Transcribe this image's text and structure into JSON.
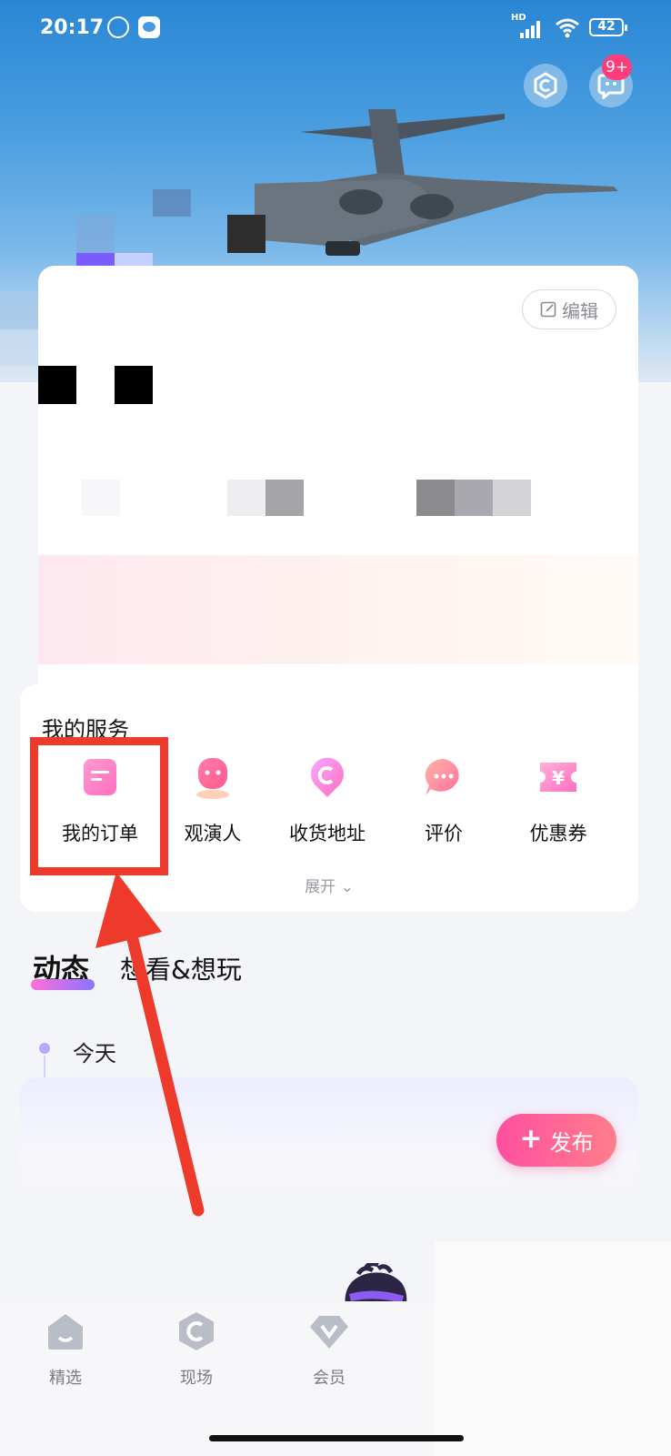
{
  "status_bar": {
    "time": "20:17",
    "network_label": "HD",
    "battery": "42"
  },
  "header": {
    "message_badge": "9+"
  },
  "profile": {
    "edit_label": "编辑"
  },
  "services": {
    "title": "我的服务",
    "items": [
      {
        "label": "我的订单",
        "icon": "order-icon"
      },
      {
        "label": "观演人",
        "icon": "audience-icon"
      },
      {
        "label": "收货地址",
        "icon": "address-icon"
      },
      {
        "label": "评价",
        "icon": "comment-icon"
      },
      {
        "label": "优惠券",
        "icon": "coupon-icon"
      }
    ],
    "expand_label": "展开"
  },
  "feed": {
    "tab_active": "动态",
    "tab_other": "想看&想玩",
    "today_label": "今天",
    "publish_label": "发布"
  },
  "bottom_nav": {
    "items": [
      {
        "label": "精选",
        "icon": "home-icon"
      },
      {
        "label": "现场",
        "icon": "live-icon"
      },
      {
        "label": "会员",
        "icon": "vip-icon"
      }
    ]
  },
  "colors": {
    "accent_pink": "#ff4fa0",
    "highlight_red": "#ee3a2a",
    "sky_blue": "#2a86d4"
  }
}
